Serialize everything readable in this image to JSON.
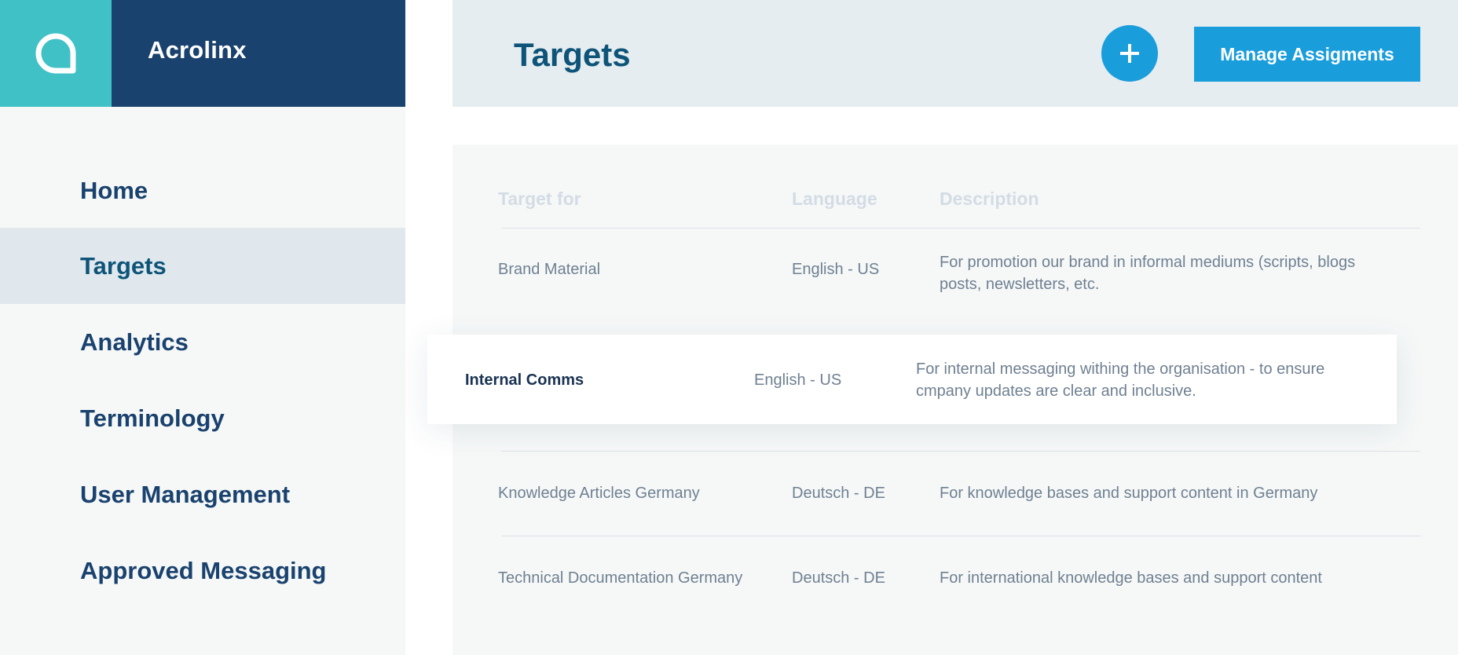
{
  "brand": {
    "name": "Acrolinx",
    "logo_icon": "acrolinx-logo-icon"
  },
  "sidebar": {
    "items": [
      {
        "label": "Home",
        "active": false
      },
      {
        "label": "Targets",
        "active": true
      },
      {
        "label": "Analytics",
        "active": false
      },
      {
        "label": "Terminology",
        "active": false
      },
      {
        "label": "User Management",
        "active": false
      },
      {
        "label": "Approved Messaging",
        "active": false
      }
    ]
  },
  "header": {
    "title": "Targets",
    "add_icon": "plus-icon",
    "manage_label": "Manage Assigments"
  },
  "table": {
    "columns": [
      "Target for",
      "Language",
      "Description"
    ],
    "rows": [
      {
        "target": "Brand Material",
        "language": "English - US",
        "description_line1": "For promotion our brand in informal mediums (scripts, blogs",
        "description_line2": "posts, newsletters, etc."
      },
      {
        "target": "Internal Comms",
        "language": "English - US",
        "description_line1": "For internal messaging withing the organisation - to ensure",
        "description_line2": "cmpany updates are clear and inclusive."
      },
      {
        "target": "Knowledge Articles Germany",
        "language": "Deutsch - DE",
        "description_line1": "For knowledge bases and support content in Germany",
        "description_line2": ""
      },
      {
        "target": "Technical Documentation Germany",
        "language": "Deutsch - DE",
        "description_line1": "For international knowledge bases and support content",
        "description_line2": ""
      }
    ]
  },
  "colors": {
    "brand_teal": "#3fc1c6",
    "brand_navy": "#1a426e",
    "accent_blue": "#1a9ddb",
    "title_blue": "#0e5478"
  }
}
